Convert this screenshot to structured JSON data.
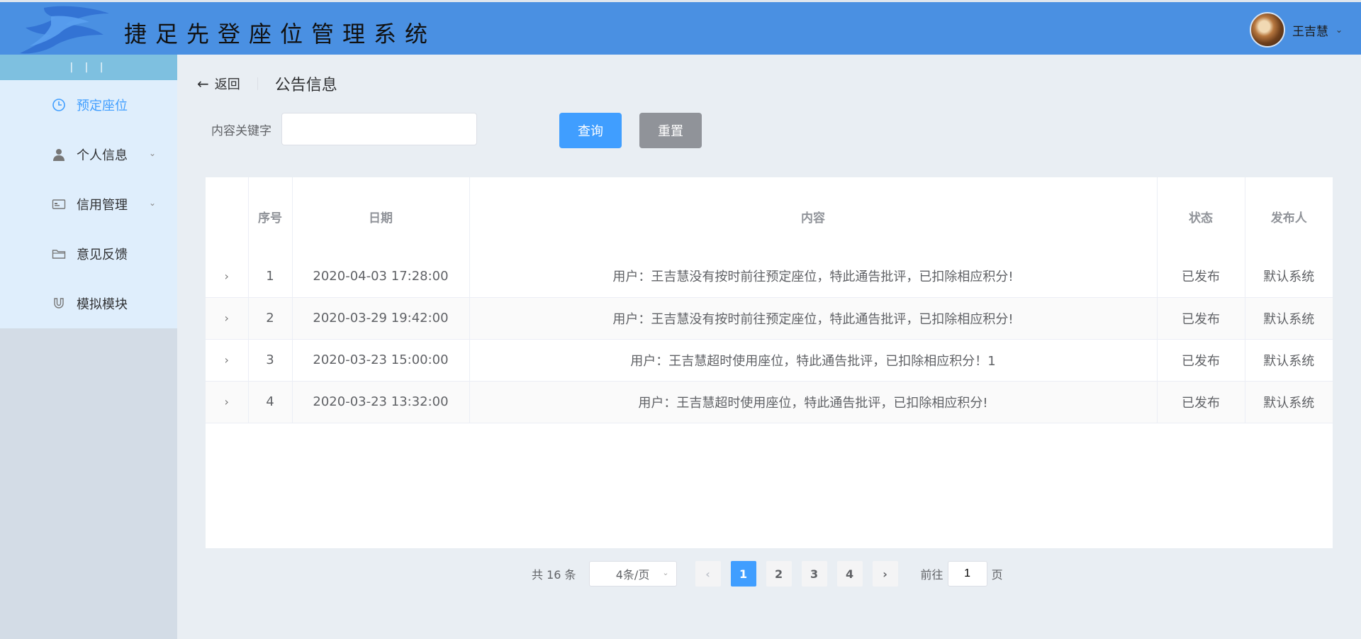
{
  "header": {
    "title": "捷足先登座位管理系统",
    "user_name": "王吉慧"
  },
  "sidebar": {
    "collapse_label": "| | |",
    "items": [
      {
        "label": "预定座位",
        "icon": "clock-icon",
        "active": true,
        "has_submenu": false
      },
      {
        "label": "个人信息",
        "icon": "user-icon",
        "active": false,
        "has_submenu": true
      },
      {
        "label": "信用管理",
        "icon": "id-card-icon",
        "active": false,
        "has_submenu": true
      },
      {
        "label": "意见反馈",
        "icon": "folder-icon",
        "active": false,
        "has_submenu": false
      },
      {
        "label": "模拟模块",
        "icon": "magnet-icon",
        "active": false,
        "has_submenu": false
      }
    ]
  },
  "page_header": {
    "back_label": "返回",
    "title": "公告信息"
  },
  "search": {
    "label": "内容关键字",
    "value": "",
    "placeholder": "",
    "query_label": "查询",
    "reset_label": "重置"
  },
  "table": {
    "columns": [
      "",
      "序号",
      "日期",
      "内容",
      "状态",
      "发布人"
    ],
    "rows": [
      {
        "no": "1",
        "date": "2020-04-03 17:28:00",
        "content": "用户：王吉慧没有按时前往预定座位，特此通告批评，已扣除相应积分!",
        "status": "已发布",
        "publisher": "默认系统"
      },
      {
        "no": "2",
        "date": "2020-03-29 19:42:00",
        "content": "用户：王吉慧没有按时前往预定座位，特此通告批评，已扣除相应积分!",
        "status": "已发布",
        "publisher": "默认系统"
      },
      {
        "no": "3",
        "date": "2020-03-23 15:00:00",
        "content": "用户：王吉慧超时使用座位，特此通告批评，已扣除相应积分！1",
        "status": "已发布",
        "publisher": "默认系统"
      },
      {
        "no": "4",
        "date": "2020-03-23 13:32:00",
        "content": "用户：王吉慧超时使用座位，特此通告批评，已扣除相应积分!",
        "status": "已发布",
        "publisher": "默认系统"
      }
    ]
  },
  "pagination": {
    "total_text": "共 16 条",
    "page_size": "4条/页",
    "pages": [
      "1",
      "2",
      "3",
      "4"
    ],
    "current_page": "1",
    "goto_label": "前往",
    "goto_value": "1",
    "page_suffix": "页"
  },
  "colors": {
    "header_bg": "#4a90e2",
    "primary": "#409eff",
    "reset_btn": "#909399",
    "sidebar_menu_bg": "#dfeefc",
    "collapse_bar": "#7ec0e0"
  }
}
